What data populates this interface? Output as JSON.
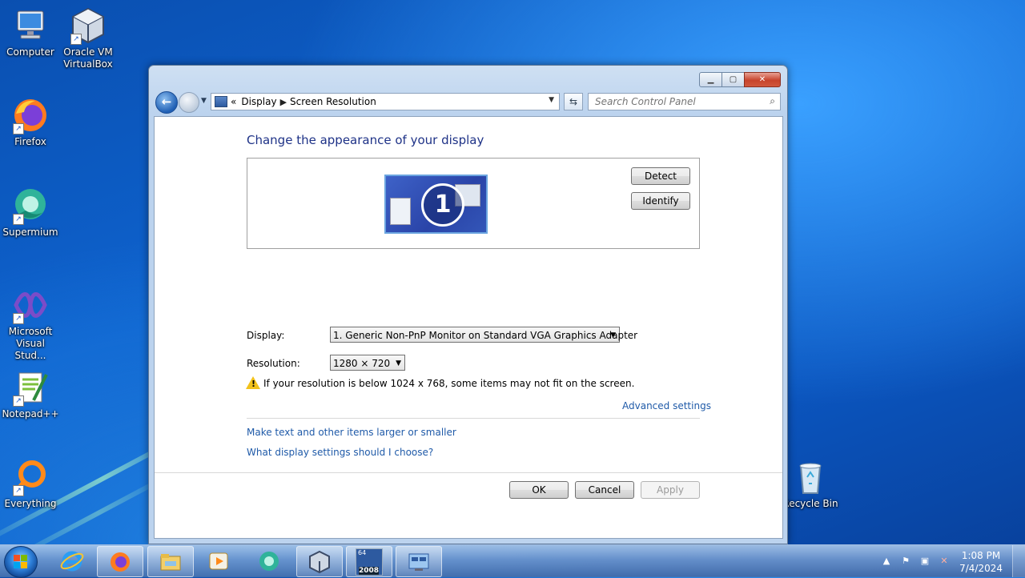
{
  "desktop": {
    "icons": [
      {
        "label": "Computer",
        "icon": "computer-icon"
      },
      {
        "label": "Oracle VM\nVirtualBox",
        "icon": "virtualbox-icon"
      },
      {
        "label": "Firefox",
        "icon": "firefox-icon"
      },
      {
        "label": "Supermium",
        "icon": "supermium-icon"
      },
      {
        "label": "Microsoft\nVisual Stud...",
        "icon": "visual-studio-icon"
      },
      {
        "label": "Notepad++",
        "icon": "notepadpp-icon"
      },
      {
        "label": "Everything",
        "icon": "everything-icon"
      },
      {
        "label": "Recycle Bin",
        "icon": "recycle-bin-icon"
      }
    ]
  },
  "window": {
    "breadcrumb": {
      "prefix": "«",
      "items": [
        "Display",
        "Screen Resolution"
      ]
    },
    "search_placeholder": "Search Control Panel",
    "heading": "Change the appearance of your display",
    "detect_label": "Detect",
    "identify_label": "Identify",
    "monitor_number": "1",
    "display_label": "Display:",
    "display_value": "1. Generic Non-PnP Monitor on Standard VGA Graphics Adapter",
    "resolution_label": "Resolution:",
    "resolution_value": "1280 × 720",
    "warning_text": "If your resolution is below 1024 x 768, some items may not fit on the screen.",
    "advanced_link": "Advanced settings",
    "link_text_size": "Make text and other items larger or smaller",
    "link_display_settings": "What display settings should I choose?",
    "ok_label": "OK",
    "cancel_label": "Cancel",
    "apply_label": "Apply"
  },
  "taskbar": {
    "pinned": [
      "ie-icon",
      "firefox-icon",
      "explorer-icon",
      "media-player-icon",
      "supermium-icon",
      "virtualbox-icon",
      "server-2008-icon",
      "control-panel-icon"
    ],
    "badge_2008": "2008",
    "badge_64": "64",
    "time": "1:08 PM",
    "date": "7/4/2024"
  },
  "colors": {
    "heading": "#1e3287",
    "link": "#1f5aa8",
    "desktop": "#0e63cf"
  }
}
